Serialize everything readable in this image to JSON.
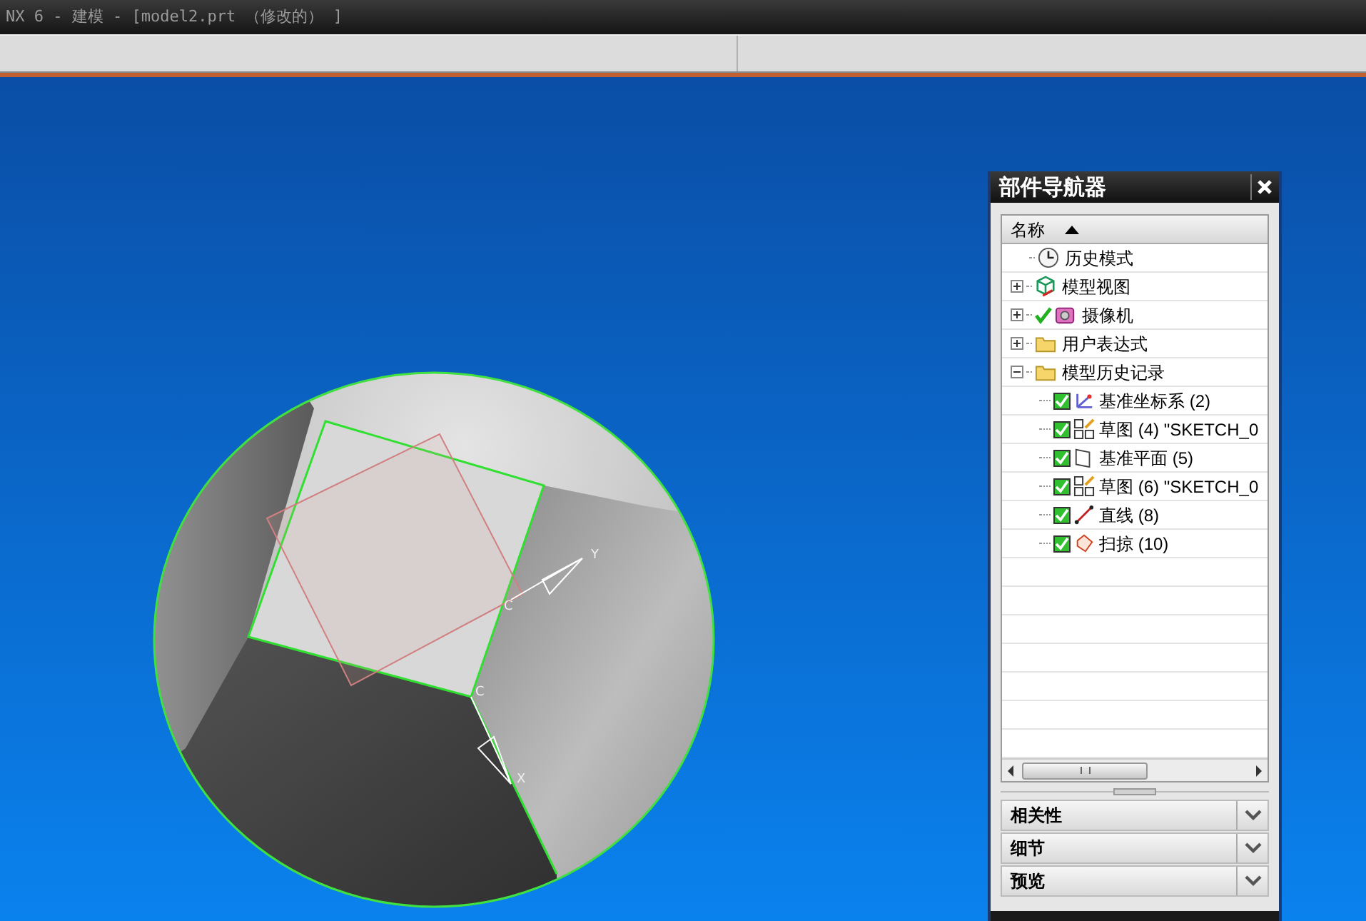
{
  "window": {
    "title": "NX 6 - 建模 - [model2.prt （修改的） ]"
  },
  "viewport": {
    "axis_labels": [
      "Y",
      "C",
      "C",
      "X"
    ]
  },
  "navigator": {
    "title": "部件导航器",
    "column": "名称",
    "tree": [
      {
        "label": "历史模式",
        "kind": "clock",
        "current": false
      },
      {
        "label": "模型视图",
        "kind": "cube",
        "expanded": false,
        "current": false
      },
      {
        "label": "摄像机",
        "kind": "camera",
        "expanded": false,
        "current": true
      },
      {
        "label": "用户表达式",
        "kind": "folder",
        "expanded": false,
        "current": false
      },
      {
        "label": "模型历史记录",
        "kind": "folder",
        "expanded": true,
        "current": false,
        "children": [
          {
            "label": "基准坐标系 (2)",
            "kind": "csys",
            "checked": true
          },
          {
            "label": "草图 (4) \"SKETCH_0",
            "kind": "sketch",
            "checked": true
          },
          {
            "label": "基准平面 (5)",
            "kind": "plane",
            "checked": true
          },
          {
            "label": "草图 (6) \"SKETCH_0",
            "kind": "sketch",
            "checked": true
          },
          {
            "label": "直线 (8)",
            "kind": "line",
            "checked": true
          },
          {
            "label": "扫掠 (10)",
            "kind": "sweep",
            "checked": true
          }
        ]
      }
    ],
    "sections": [
      {
        "label": "相关性",
        "expanded": false
      },
      {
        "label": "细节",
        "expanded": false
      },
      {
        "label": "预览",
        "expanded": false
      }
    ]
  }
}
